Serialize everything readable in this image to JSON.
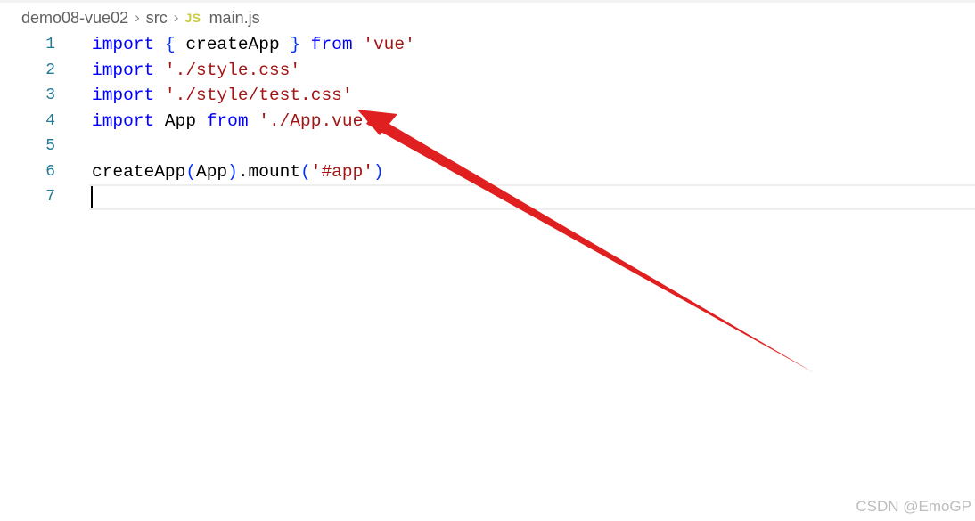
{
  "breadcrumb": {
    "folder": "demo08-vue02",
    "subfolder": "src",
    "file_icon": "JS",
    "file": "main.js"
  },
  "editor": {
    "lines": [
      {
        "number": "1",
        "tokens": [
          "import",
          " ",
          "{",
          " createApp ",
          "}",
          " ",
          "from",
          " ",
          "'vue'"
        ]
      },
      {
        "number": "2",
        "tokens": [
          "import",
          " ",
          "'./style.css'"
        ]
      },
      {
        "number": "3",
        "tokens": [
          "import",
          " ",
          "'./style/test.css'"
        ]
      },
      {
        "number": "4",
        "tokens": [
          "import",
          " App ",
          "from",
          " ",
          "'./App.vue'"
        ]
      },
      {
        "number": "5",
        "tokens": []
      },
      {
        "number": "6",
        "tokens": [
          "createApp",
          "(",
          "App",
          ")",
          ".mount",
          "(",
          "'#app'",
          ")"
        ]
      },
      {
        "number": "7",
        "tokens": []
      }
    ]
  },
  "annotation": {
    "arrow_color": "#e02020"
  },
  "watermark": "CSDN @EmoGP"
}
